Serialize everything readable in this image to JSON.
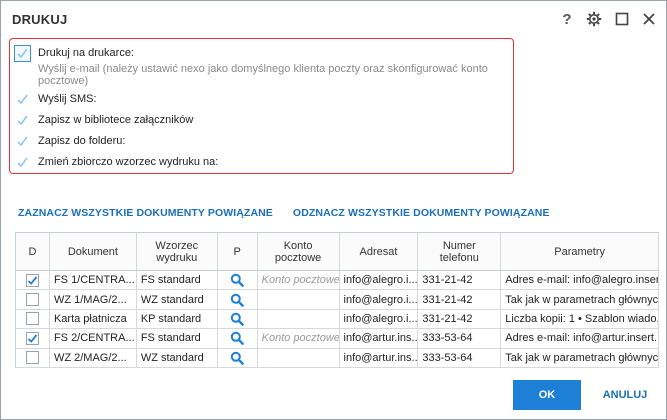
{
  "dialog": {
    "title": "DRUKUJ",
    "help_glyph": "?"
  },
  "options": [
    {
      "label": "Drukuj na drukarce:",
      "checked": false,
      "has_checkbox": true,
      "muted": false
    },
    {
      "label": "Wyślij e-mail (należy ustawić nexo jako domyślnego klienta poczty oraz skonfigurować konto pocztowe)",
      "has_checkbox": false,
      "muted": true
    },
    {
      "label": "Wyślij SMS:",
      "checked": false,
      "has_checkbox": true,
      "muted": false
    },
    {
      "label": "Zapisz w bibliotece załączników",
      "checked": false,
      "has_checkbox": true,
      "muted": false
    },
    {
      "label": "Zapisz do folderu:",
      "checked": false,
      "has_checkbox": true,
      "muted": false
    },
    {
      "label": "Zmień zbiorczo wzorzec wydruku na:",
      "checked": false,
      "has_checkbox": true,
      "muted": false
    }
  ],
  "links": {
    "select_all": "ZAZNACZ WSZYSTKIE DOKUMENTY POWIĄZANE",
    "deselect_all": "ODZNACZ WSZYSTKIE DOKUMENTY POWIĄZANE"
  },
  "table": {
    "headers": {
      "d": "D",
      "doc": "Dokument",
      "wz": "Wzorzec wydruku",
      "p": "P",
      "konto": "Konto pocztowe",
      "adr": "Adresat",
      "tel": "Numer telefonu",
      "par": "Parametry"
    },
    "rows": [
      {
        "checked": true,
        "doc": "FS 1/CENTRA...",
        "wz": "FS standard",
        "konto": "Konto pocztowe",
        "adr": "info@alegro.i...",
        "tel": "331-21-42",
        "par": "Adres e-mail: info@alegro.insert..."
      },
      {
        "checked": false,
        "doc": "WZ 1/MAG/2...",
        "wz": "WZ standard",
        "konto": "",
        "adr": "info@alegro.i...",
        "tel": "331-21-42",
        "par": "Tak jak w parametrach głównych"
      },
      {
        "checked": false,
        "doc": "Karta płatnicza",
        "wz": "KP standard",
        "konto": "",
        "adr": "info@alegro.i...",
        "tel": "331-21-42",
        "par": "Liczba kopii: 1 • Szablon wiado..."
      },
      {
        "checked": true,
        "doc": "FS 2/CENTRA...",
        "wz": "FS standard",
        "konto": "Konto pocztowe",
        "adr": "info@artur.ins...",
        "tel": "333-53-64",
        "par": "Adres e-mail: info@artur.insert...."
      },
      {
        "checked": false,
        "doc": "WZ 2/MAG/2...",
        "wz": "WZ standard",
        "konto": "",
        "adr": "info@artur.ins...",
        "tel": "333-53-64",
        "par": "Tak jak w parametrach głównych"
      }
    ]
  },
  "buttons": {
    "ok": "OK",
    "cancel": "ANULUJ"
  },
  "colors": {
    "accent": "#1e7fd6",
    "highlight_border": "#e0343b",
    "check": "#6db3e8"
  }
}
